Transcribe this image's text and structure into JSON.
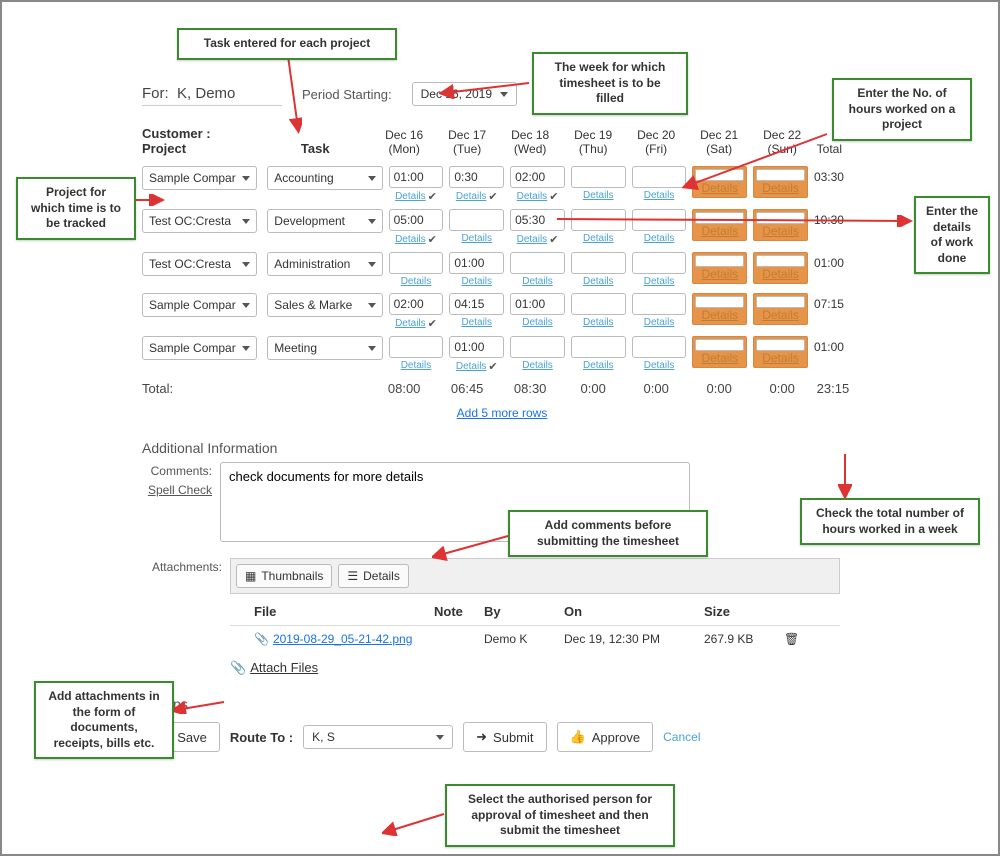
{
  "for_label_prefix": "For:",
  "for_name": "K, Demo",
  "period_starting_label": "Period Starting:",
  "period_starting_value": "Dec 16, 2019",
  "headers": {
    "customer_project": "Customer : Project",
    "task": "Task",
    "days": [
      {
        "d": "Dec 16",
        "w": "(Mon)"
      },
      {
        "d": "Dec 17",
        "w": "(Tue)"
      },
      {
        "d": "Dec 18",
        "w": "(Wed)"
      },
      {
        "d": "Dec 19",
        "w": "(Thu)"
      },
      {
        "d": "Dec 20",
        "w": "(Fri)"
      },
      {
        "d": "Dec 21",
        "w": "(Sat)"
      },
      {
        "d": "Dec 22",
        "w": "(Sun)"
      }
    ],
    "total": "Total"
  },
  "rows": [
    {
      "project": "Sample Compar",
      "task": "Accounting",
      "cells": [
        "01:00",
        "0:30",
        "02:00",
        "",
        "",
        "",
        ""
      ],
      "checks": [
        true,
        true,
        true,
        false,
        false,
        false,
        false
      ],
      "total": "03:30"
    },
    {
      "project": "Test OC:Cresta",
      "task": "Development",
      "cells": [
        "05:00",
        "",
        "05:30",
        "",
        "",
        "",
        ""
      ],
      "checks": [
        true,
        false,
        true,
        false,
        false,
        false,
        false
      ],
      "total": "10:30"
    },
    {
      "project": "Test OC:Cresta",
      "task": "Administration",
      "cells": [
        "",
        "01:00",
        "",
        "",
        "",
        "",
        ""
      ],
      "checks": [
        false,
        false,
        false,
        false,
        false,
        false,
        false
      ],
      "total": "01:00"
    },
    {
      "project": "Sample Compar",
      "task": "Sales & Marke",
      "cells": [
        "02:00",
        "04:15",
        "01:00",
        "",
        "",
        "",
        ""
      ],
      "checks": [
        true,
        false,
        false,
        false,
        false,
        false,
        false
      ],
      "total": "07:15"
    },
    {
      "project": "Sample Compar",
      "task": "Meeting",
      "cells": [
        "",
        "01:00",
        "",
        "",
        "",
        "",
        ""
      ],
      "checks": [
        false,
        true,
        false,
        false,
        false,
        false,
        false
      ],
      "total": "01:00"
    }
  ],
  "totals_label": "Total:",
  "day_totals": [
    "08:00",
    "06:45",
    "08:30",
    "0:00",
    "0:00",
    "0:00",
    "0:00"
  ],
  "grand_total": "23:15",
  "details_label": "Details",
  "add_rows_label": "Add 5 more rows",
  "additional_info_title": "Additional Information",
  "comments_label": "Comments:",
  "spell_check_label": "Spell Check",
  "comments_value": "check documents for more details",
  "attachments_label": "Attachments:",
  "thumb_btn": "Thumbnails",
  "details_btn": "Details",
  "att_headers": {
    "file": "File",
    "note": "Note",
    "by": "By",
    "on": "On",
    "size": "Size"
  },
  "attachment": {
    "file": "2019-08-29_05-21-42.png",
    "note": "",
    "by": "Demo K",
    "on": "Dec 19, 12:30 PM",
    "size": "267.9 KB"
  },
  "attach_files_label": "Attach Files",
  "actions_title": "Actions",
  "save_label": "Save",
  "route_to_label": "Route To :",
  "route_to_value": "K, S",
  "submit_label": "Submit",
  "approve_label": "Approve",
  "cancel_label": "Cancel",
  "callouts": {
    "task": "Task entered for each project",
    "week": "The week for which timesheet is to be filled",
    "hours": "Enter the No. of hours worked on a project",
    "project": "Project for which time is to be tracked",
    "details": "Enter the details of work done",
    "total": "Check the total number of hours worked in a week",
    "comments": "Add comments before submitting the timesheet",
    "attach": "Add attachments in the form of documents, receipts, bills etc.",
    "route": "Select the authorised person for approval of timesheet and then submit the timesheet"
  }
}
